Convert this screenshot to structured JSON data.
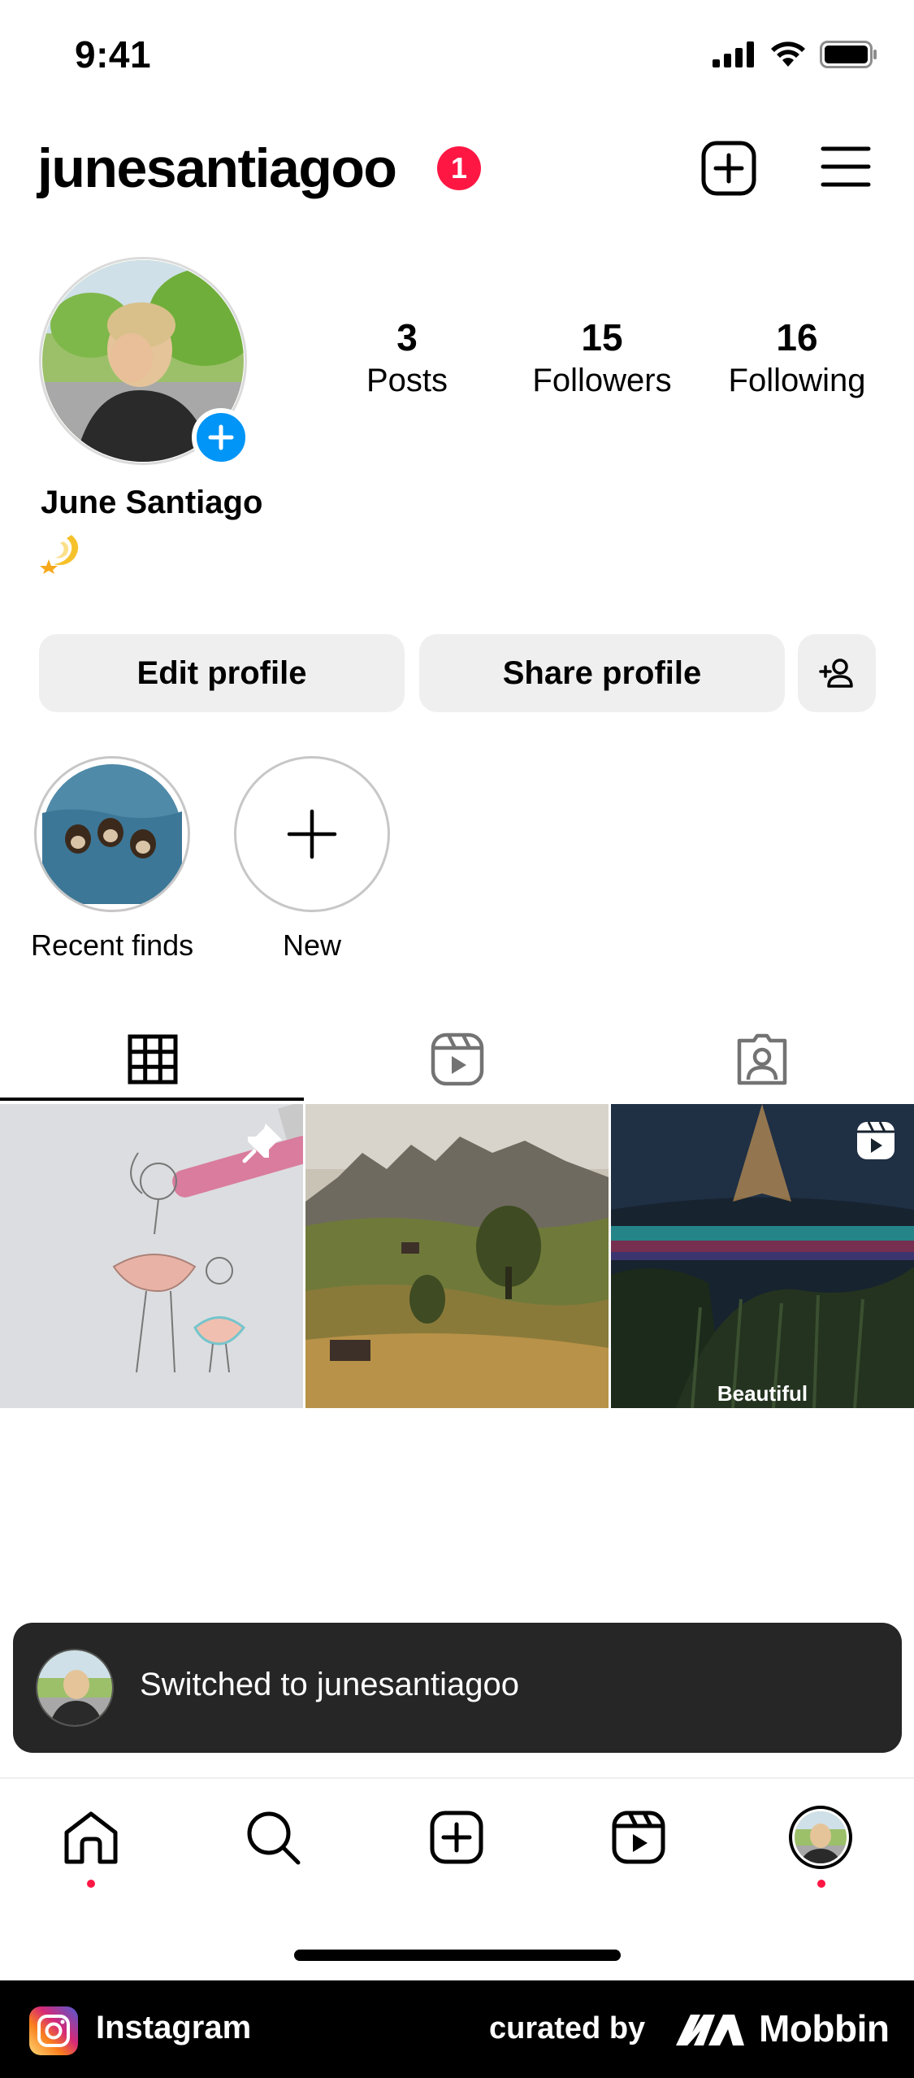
{
  "status_bar": {
    "time": "9:41"
  },
  "header": {
    "username": "junesantiagoo",
    "notification_count": "1"
  },
  "profile": {
    "display_name": "June Santiago",
    "bio_emoji": "dizzy-emoji",
    "stats": [
      {
        "value": "3",
        "label": "Posts"
      },
      {
        "value": "15",
        "label": "Followers"
      },
      {
        "value": "16",
        "label": "Following"
      }
    ]
  },
  "buttons": {
    "edit": "Edit profile",
    "share": "Share profile"
  },
  "highlights": [
    {
      "label": "Recent finds"
    },
    {
      "label": "New"
    }
  ],
  "tabs": [
    "grid-icon",
    "reels-icon",
    "tagged-icon"
  ],
  "grid": {
    "posts": [
      {
        "name": "ballerina-drawing-post",
        "pinned": true
      },
      {
        "name": "mountain-landscape-post"
      },
      {
        "name": "northern-lights-reel-post",
        "is_reel": true,
        "caption": "Beautiful"
      }
    ]
  },
  "toast": {
    "text": "Switched to junesantiagoo"
  },
  "tab_bar": [
    "home-icon",
    "search-icon",
    "create-icon",
    "reels-icon",
    "profile-avatar"
  ],
  "footer": {
    "app_name": "Instagram",
    "curated_by": "curated by",
    "brand": "Mobbin"
  },
  "colors": {
    "accent_blue": "#0095f6",
    "badge_red": "#ff1744",
    "toast_bg": "#262626",
    "button_bg": "#efefef"
  }
}
